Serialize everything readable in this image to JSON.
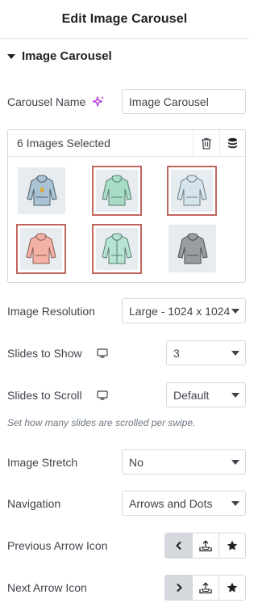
{
  "header": {
    "title": "Edit Image Carousel"
  },
  "section": {
    "title": "Image Carousel"
  },
  "carousel_name": {
    "label": "Carousel Name",
    "value": "Image Carousel"
  },
  "gallery": {
    "count_label": "6 Images Selected"
  },
  "image_resolution": {
    "label": "Image Resolution",
    "value": "Large - 1024 x 1024"
  },
  "slides_to_show": {
    "label": "Slides to Show",
    "value": "3"
  },
  "slides_to_scroll": {
    "label": "Slides to Scroll",
    "value": "Default",
    "hint": "Set how many slides are scrolled per swipe."
  },
  "image_stretch": {
    "label": "Image Stretch",
    "value": "No"
  },
  "navigation": {
    "label": "Navigation",
    "value": "Arrows and Dots"
  },
  "previous_arrow": {
    "label": "Previous Arrow Icon"
  },
  "next_arrow": {
    "label": "Next Arrow Icon"
  },
  "colors": {
    "accent": "#c0665f",
    "ai": "#b32fd8"
  }
}
